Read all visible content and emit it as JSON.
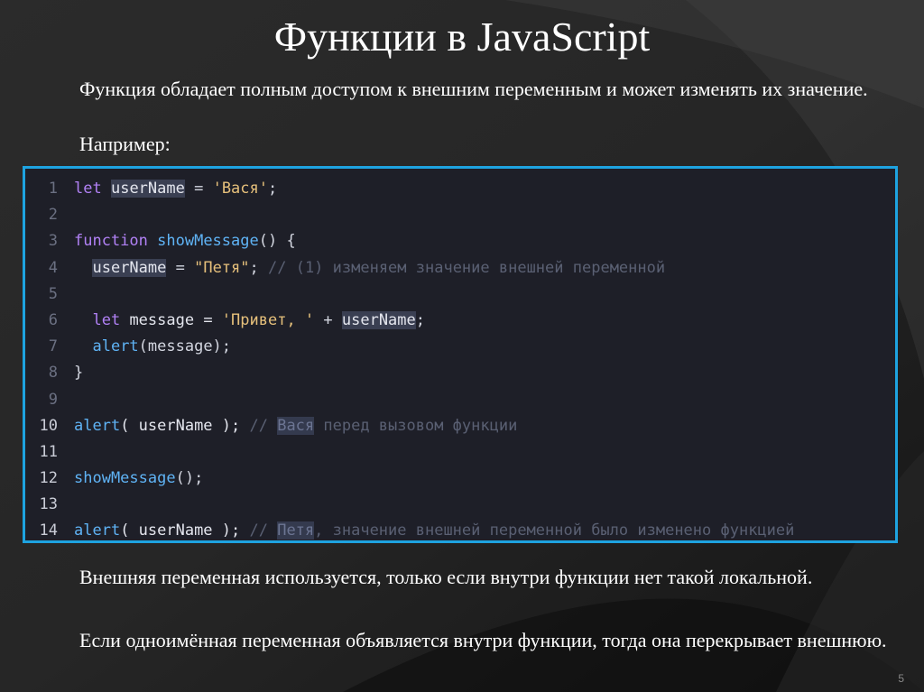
{
  "slide": {
    "title": "Функции в JavaScript",
    "intro_line": "Функция обладает полным доступом к внешним переменным и может изменять их значение.",
    "example_label": "Например:",
    "outro_1": "Внешняя переменная используется, только если внутри функции нет такой локальной.",
    "outro_2": "Если одноимённая переменная объявляется внутри функции, тогда она перекрывает внешнюю.",
    "page_number": "5"
  },
  "code": {
    "line_numbers": [
      "1",
      "2",
      "3",
      "4",
      "5",
      "6",
      "7",
      "8",
      "9",
      "10",
      "11",
      "12",
      "13",
      "14"
    ],
    "l1_kw": "let",
    "l1_var": "userName",
    "l1_op": " = ",
    "l1_str": "'Вася'",
    "l1_end": ";",
    "l3_kw": "function",
    "l3_fn": "showMessage",
    "l3_end": "() {",
    "l4_var": "userName",
    "l4_op": " = ",
    "l4_str": "\"Петя\"",
    "l4_end": "; ",
    "l4_comment": "// (1) изменяем значение внешней переменной",
    "l6_kw": "let",
    "l6_var": " message = ",
    "l6_str": "'Привет, '",
    "l6_op": " + ",
    "l6_var2": "userName",
    "l6_end": ";",
    "l7_fn": "alert",
    "l7_rest": "(message);",
    "l8_text": "}",
    "l10_fn": "alert",
    "l10_rest": "( userName ); ",
    "l10_comment_a": "// ",
    "l10_comment_hl": "Вася",
    "l10_comment_b": " перед вызовом функции",
    "l12_fn": "showMessage",
    "l12_rest": "();",
    "l14_fn": "alert",
    "l14_rest": "( userName ); ",
    "l14_comment_a": "// ",
    "l14_comment_hl": "Петя",
    "l14_comment_b": ", значение внешней переменной было изменено функцией"
  }
}
